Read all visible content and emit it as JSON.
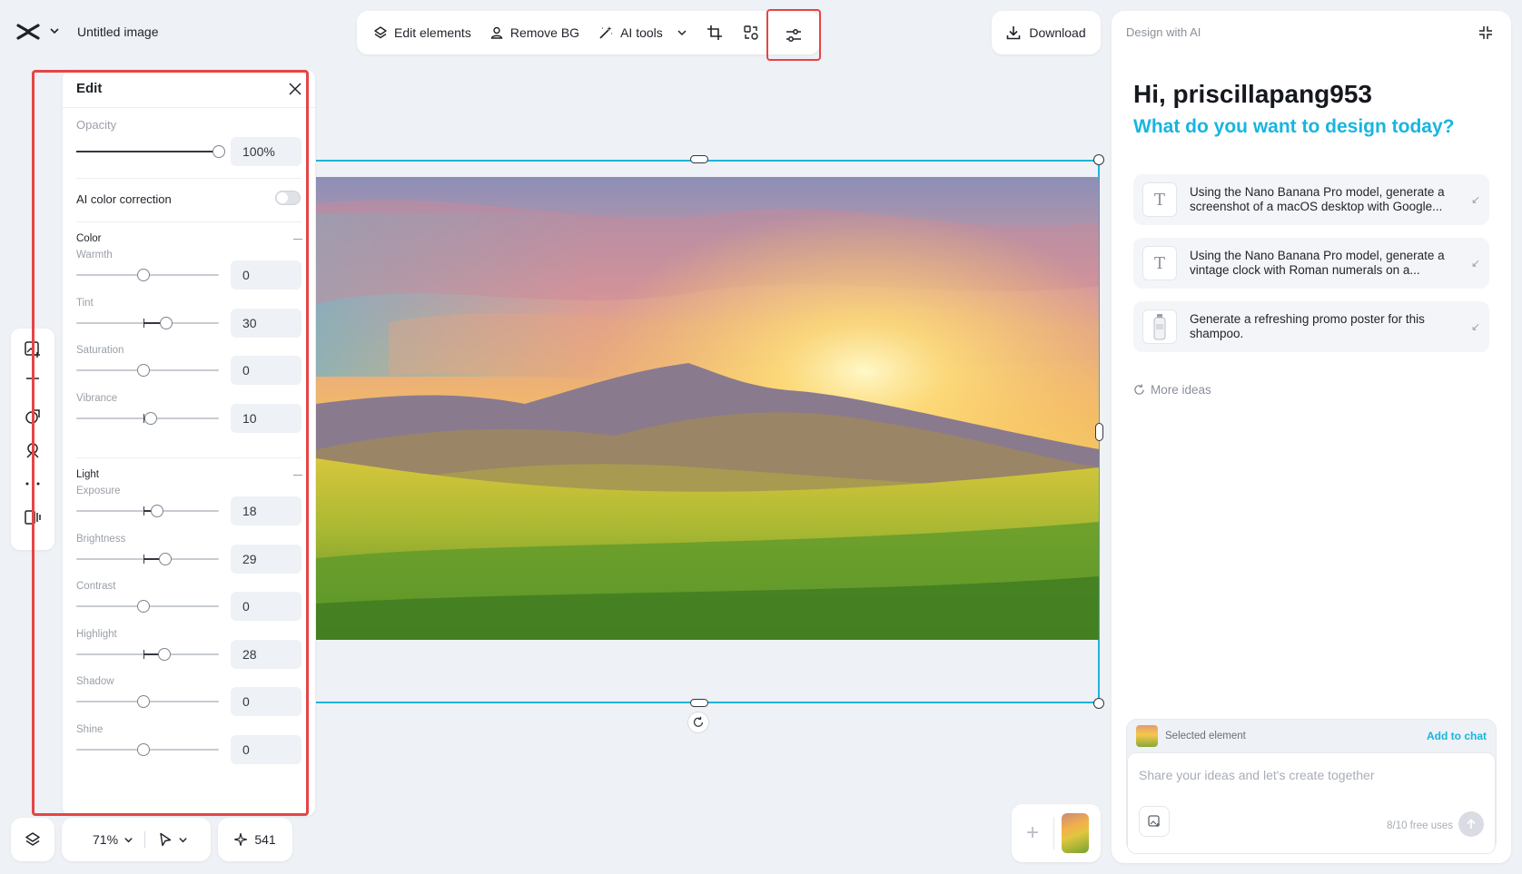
{
  "header": {
    "doc_title": "Untitled image"
  },
  "toolbar": {
    "edit_elements": "Edit elements",
    "remove_bg": "Remove BG",
    "ai_tools": "AI tools",
    "download": "Download"
  },
  "edit_panel": {
    "title": "Edit",
    "opacity": {
      "label": "Opacity",
      "value": "100%",
      "level": 100
    },
    "ai_color_correction": {
      "label": "AI color correction",
      "enabled": false
    },
    "color_section": "Color",
    "light_section": "Light",
    "controls": [
      {
        "label": "Warmth",
        "value": "0"
      },
      {
        "label": "Tint",
        "value": "30"
      },
      {
        "label": "Saturation",
        "value": "0"
      },
      {
        "label": "Vibrance",
        "value": "10"
      },
      {
        "label": "Exposure",
        "value": "18"
      },
      {
        "label": "Brightness",
        "value": "29"
      },
      {
        "label": "Contrast",
        "value": "0"
      },
      {
        "label": "Highlight",
        "value": "28"
      },
      {
        "label": "Shadow",
        "value": "0"
      },
      {
        "label": "Shine",
        "value": "0"
      }
    ]
  },
  "ai_panel": {
    "header": "Design with AI",
    "greeting": "Hi, priscillapang953",
    "question": "What do you want to design today?",
    "ideas": [
      {
        "text": "Using the Nano Banana Pro model, generate a screenshot of a macOS desktop with Google..."
      },
      {
        "text": "Using the Nano Banana Pro model, generate a vintage clock with Roman numerals on a..."
      },
      {
        "text": "Generate a refreshing promo poster for this shampoo."
      }
    ],
    "more_ideas": "More ideas",
    "selected_element": "Selected element",
    "add_to_chat": "Add to chat",
    "chat_placeholder": "Share your ideas and let's create together",
    "free_uses": "8/10 free uses"
  },
  "bottom": {
    "zoom": "71%",
    "credits": "541"
  },
  "colors": {
    "accent": "#17b5e0",
    "highlight_outline": "#e54545",
    "selection": "#1fb3d8"
  }
}
